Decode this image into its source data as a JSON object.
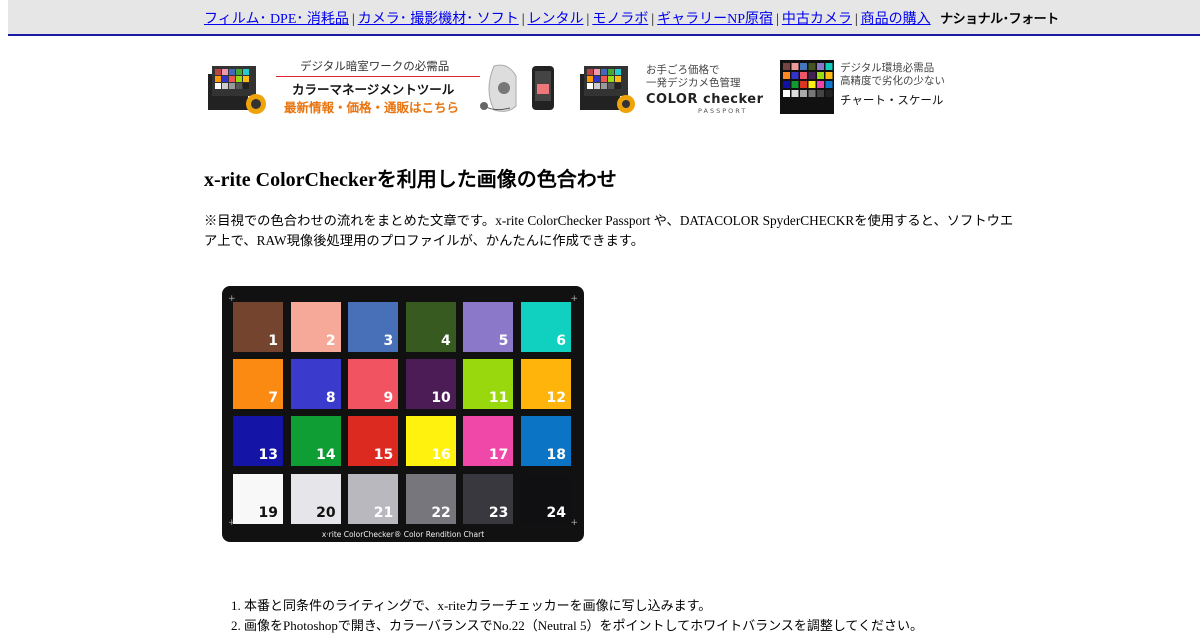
{
  "nav": {
    "links": [
      "フィルム･ DPE･ 消耗品",
      "カメラ･ 撮影機材･ ソフト",
      "レンタル",
      "モノラボ",
      "ギャラリーNP原宿",
      "中古カメラ",
      "商品の購入"
    ],
    "separator": "|",
    "brand": "ナショナル･フォート"
  },
  "banners": {
    "color_management": {
      "line1": "デジタル暗室ワークの必需品",
      "line2": "カラーマネージメントツール",
      "line3": "最新情報・価格・通販はこちら"
    },
    "passport": {
      "line1": "お手ごろ価格で",
      "line2": "一発デジカメ色管理",
      "logo": "COLOR checker",
      "logo_sub": "PASSPORT"
    },
    "chart_scale": {
      "line1": "デジタル環境必需品",
      "line2": "高精度で劣化の少ない",
      "line3": "チャート・スケール"
    }
  },
  "page": {
    "title": "x-rite ColorCheckerを利用した画像の色合わせ",
    "intro": "※目視での色合わせの流れをまとめた文章です。x-rite ColorChecker Passport や、DATACOLOR SpyderCHECKRを使用すると、ソフトウエア上で、RAW現像後処理用のプロファイルが、かんたんに作成できます。"
  },
  "colorchecker": {
    "label": "x·rite ColorChecker® Color Rendition Chart",
    "patches": [
      {
        "num": "1",
        "color": "#74442e"
      },
      {
        "num": "2",
        "color": "#f6a899"
      },
      {
        "num": "3",
        "color": "#4870b8"
      },
      {
        "num": "4",
        "color": "#375a20"
      },
      {
        "num": "5",
        "color": "#8c78c8"
      },
      {
        "num": "6",
        "color": "#10d0c0"
      },
      {
        "num": "7",
        "color": "#fb8a12"
      },
      {
        "num": "8",
        "color": "#3a3acc"
      },
      {
        "num": "9",
        "color": "#f25360"
      },
      {
        "num": "10",
        "color": "#4c1c56"
      },
      {
        "num": "11",
        "color": "#9ad80e"
      },
      {
        "num": "12",
        "color": "#ffb40c"
      },
      {
        "num": "13",
        "color": "#1414a6"
      },
      {
        "num": "14",
        "color": "#0e9e34"
      },
      {
        "num": "15",
        "color": "#dd2a20"
      },
      {
        "num": "16",
        "color": "#fff20e"
      },
      {
        "num": "17",
        "color": "#f048a8"
      },
      {
        "num": "18",
        "color": "#0c74c4"
      },
      {
        "num": "19",
        "color": "#f8f8f8"
      },
      {
        "num": "20",
        "color": "#e6e6ea"
      },
      {
        "num": "21",
        "color": "#b8b8be"
      },
      {
        "num": "22",
        "color": "#76767c"
      },
      {
        "num": "23",
        "color": "#38383e"
      },
      {
        "num": "24",
        "color": "#101012"
      }
    ]
  },
  "steps": [
    "本番と同条件のライティングで、x-riteカラーチェッカーを画像に写し込みます。",
    "画像をPhotoshopで開き、カラーバランスでNo.22（Neutral 5）をポイントしてホワイトバランスを調整してください。"
  ]
}
